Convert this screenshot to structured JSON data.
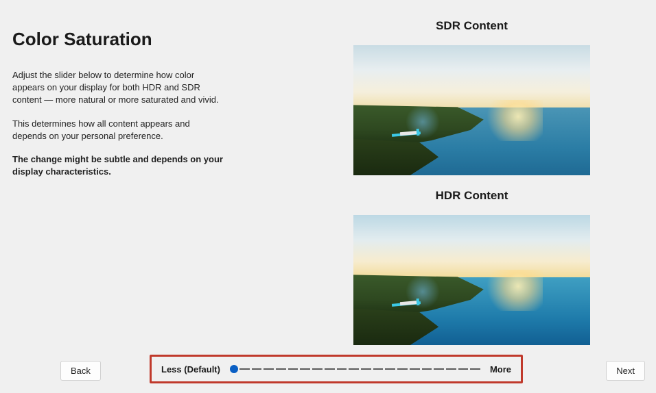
{
  "title": "Color Saturation",
  "descriptions": {
    "p1": "Adjust the slider below to determine how color appears on your display for both HDR and SDR content — more natural or more saturated and vivid.",
    "p2": "This determines how all content appears and depends on your personal preference.",
    "p3": "The change might be subtle and depends on your display characteristics."
  },
  "previews": {
    "sdr_label": "SDR Content",
    "hdr_label": "HDR Content"
  },
  "slider": {
    "less_label": "Less (Default)",
    "more_label": "More"
  },
  "buttons": {
    "back": "Back",
    "next": "Next"
  }
}
